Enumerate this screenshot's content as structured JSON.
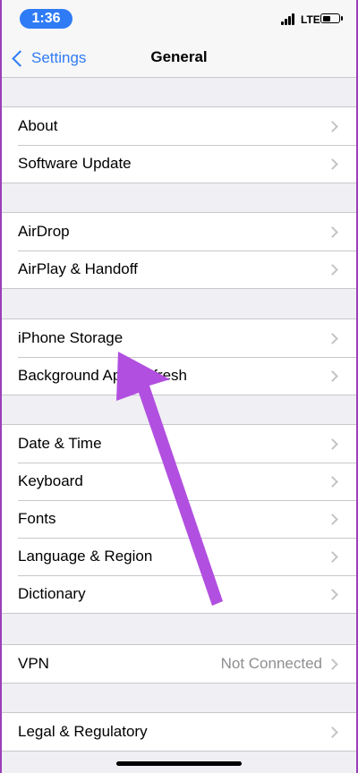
{
  "status_bar": {
    "time": "1:36",
    "carrier": "LTE",
    "battery_level": 0.55
  },
  "nav": {
    "back_label": "Settings",
    "title": "General"
  },
  "groups": [
    {
      "rows": [
        {
          "label": "About"
        },
        {
          "label": "Software Update"
        }
      ]
    },
    {
      "rows": [
        {
          "label": "AirDrop"
        },
        {
          "label": "AirPlay & Handoff"
        }
      ]
    },
    {
      "rows": [
        {
          "label": "iPhone Storage"
        },
        {
          "label": "Background App Refresh"
        }
      ]
    },
    {
      "rows": [
        {
          "label": "Date & Time"
        },
        {
          "label": "Keyboard"
        },
        {
          "label": "Fonts"
        },
        {
          "label": "Language & Region"
        },
        {
          "label": "Dictionary"
        }
      ]
    },
    {
      "rows": [
        {
          "label": "VPN",
          "value": "Not Connected"
        }
      ]
    },
    {
      "rows": [
        {
          "label": "Legal & Regulatory"
        }
      ]
    }
  ],
  "colors": {
    "accent": "#2f7bf6",
    "annotation_arrow": "#b14fe0"
  }
}
